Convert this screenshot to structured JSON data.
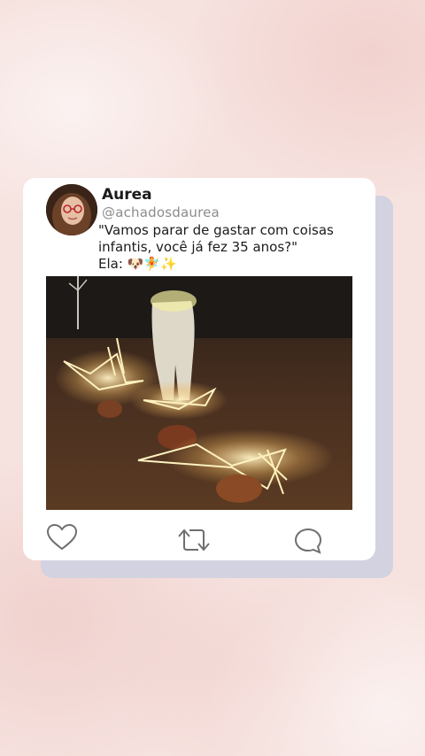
{
  "post": {
    "name": "Aurea",
    "handle": "@achadosdaurea",
    "text_line1": "\"Vamos parar de gastar com coisas",
    "text_line2": "infantis, você já fez 35 anos?\"",
    "text_line3": "Ela: 🐶🧚✨"
  },
  "media": {
    "description_icon": "video-thumbnail"
  },
  "actions": {
    "icons": [
      "heart-icon",
      "retweet-icon",
      "comment-icon"
    ]
  },
  "colors": {
    "background": "#f6e2df",
    "card": "#ffffff",
    "card_shadow": "#d3d2e0",
    "handle": "#8c8c8c"
  }
}
